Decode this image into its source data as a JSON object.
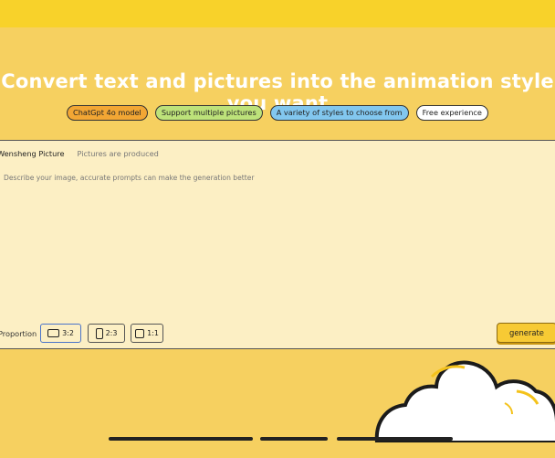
{
  "hero": {
    "title": "Convert text and pictures into the animation style you want",
    "tags": [
      {
        "label": "ChatGpt 4o model",
        "color": "#f2a634"
      },
      {
        "label": "Support multiple pictures",
        "color": "#bde27a"
      },
      {
        "label": "A variety of styles to choose from",
        "color": "#82c7ef"
      },
      {
        "label": "Free experience",
        "color": "#ffffff"
      }
    ]
  },
  "editor": {
    "tabs": [
      "Wensheng Picture",
      "Pictures are produced"
    ],
    "active_tab": "Wensheng Picture",
    "prompt": {
      "value": "",
      "placeholder": "Describe your image, accurate prompts can make the generation better"
    },
    "proportion_label": "Proportion",
    "ratios": [
      "3:2",
      "2:3",
      "1:1"
    ],
    "selected_ratio": "3:2",
    "generate_label": "generate"
  },
  "colors": {
    "page_bg": "#f6d060",
    "top_bar": "#f8d22a",
    "panel_bg": "#fcefc4",
    "accent_selected": "#4a74c9",
    "generate_bg": "#f7ca34"
  },
  "icons": {
    "cloud": "cloud-illustration"
  }
}
